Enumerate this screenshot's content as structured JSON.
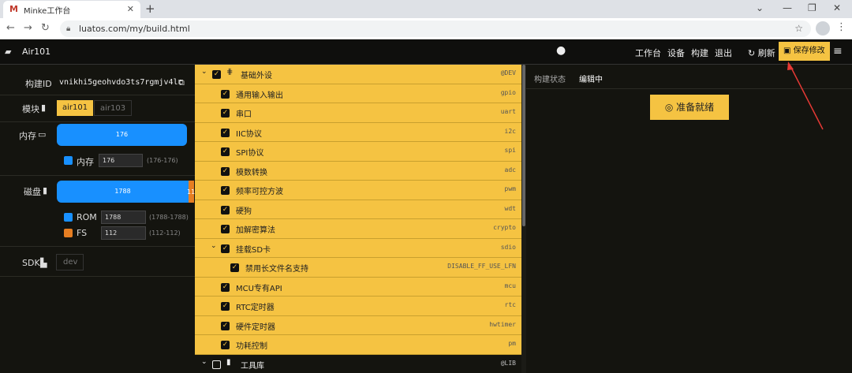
{
  "browser": {
    "tab_title": "Minke工作台",
    "url": "luatos.com/my/build.html"
  },
  "header": {
    "project": "Air101",
    "nav": [
      "工作台",
      "设备",
      "构建",
      "退出"
    ],
    "refresh_label": "刷新",
    "save_label": "保存修改"
  },
  "left": {
    "build_id_label": "构建ID",
    "build_id": "vnikhi5geohvdo3ts7rgmjv4lc",
    "module_label": "模块",
    "modules": [
      "air101",
      "air103"
    ],
    "selected_module": "air101",
    "memory_label": "内存",
    "memory_value": "176",
    "memory_legend": "内存",
    "memory_input": "176",
    "memory_range": "(176-176)",
    "disk_label": "磁盘",
    "disk_value": "1788",
    "disk_over_label": "11",
    "rom_label": "ROM",
    "rom_input": "1788",
    "rom_range": "(1788-1788)",
    "fs_label": "FS",
    "fs_input": "112",
    "fs_range": "(112-112)",
    "sdk_label": "SDK",
    "sdk_value": "dev",
    "colors": {
      "memory": "#1890ff",
      "fs": "#e67e22",
      "accent": "#f5c342"
    }
  },
  "items": [
    {
      "name": "基础外设",
      "tag": "@DEV",
      "level": 0,
      "group": true,
      "checked": true
    },
    {
      "name": "通用输入输出",
      "tag": "gpio",
      "level": 1,
      "checked": true
    },
    {
      "name": "串口",
      "tag": "uart",
      "level": 1,
      "checked": true
    },
    {
      "name": "IIC协议",
      "tag": "i2c",
      "level": 1,
      "checked": true
    },
    {
      "name": "SPI协议",
      "tag": "spi",
      "level": 1,
      "checked": true
    },
    {
      "name": "模数转换",
      "tag": "adc",
      "level": 1,
      "checked": true
    },
    {
      "name": "频率可控方波",
      "tag": "pwm",
      "level": 1,
      "checked": true
    },
    {
      "name": "硬狗",
      "tag": "wdt",
      "level": 1,
      "checked": true
    },
    {
      "name": "加解密算法",
      "tag": "crypto",
      "level": 1,
      "checked": true
    },
    {
      "name": "挂载SD卡",
      "tag": "sdio",
      "level": 1,
      "expandable": true,
      "checked": true
    },
    {
      "name": "禁用长文件名支持",
      "tag": "DISABLE_FF_USE_LFN",
      "level": 2,
      "checked": true
    },
    {
      "name": "MCU专有API",
      "tag": "mcu",
      "level": 1,
      "checked": true
    },
    {
      "name": "RTC定时器",
      "tag": "rtc",
      "level": 1,
      "checked": true
    },
    {
      "name": "硬件定时器",
      "tag": "hwtimer",
      "level": 1,
      "checked": true
    },
    {
      "name": "功耗控制",
      "tag": "pm",
      "level": 1,
      "checked": true
    },
    {
      "name": "工具库",
      "tag": "@LIB",
      "level": 0,
      "group": true,
      "dark": true,
      "checked": false
    }
  ],
  "right": {
    "status_label": "构建状态",
    "status_value": "编辑中",
    "ready_label": "准备就绪"
  }
}
